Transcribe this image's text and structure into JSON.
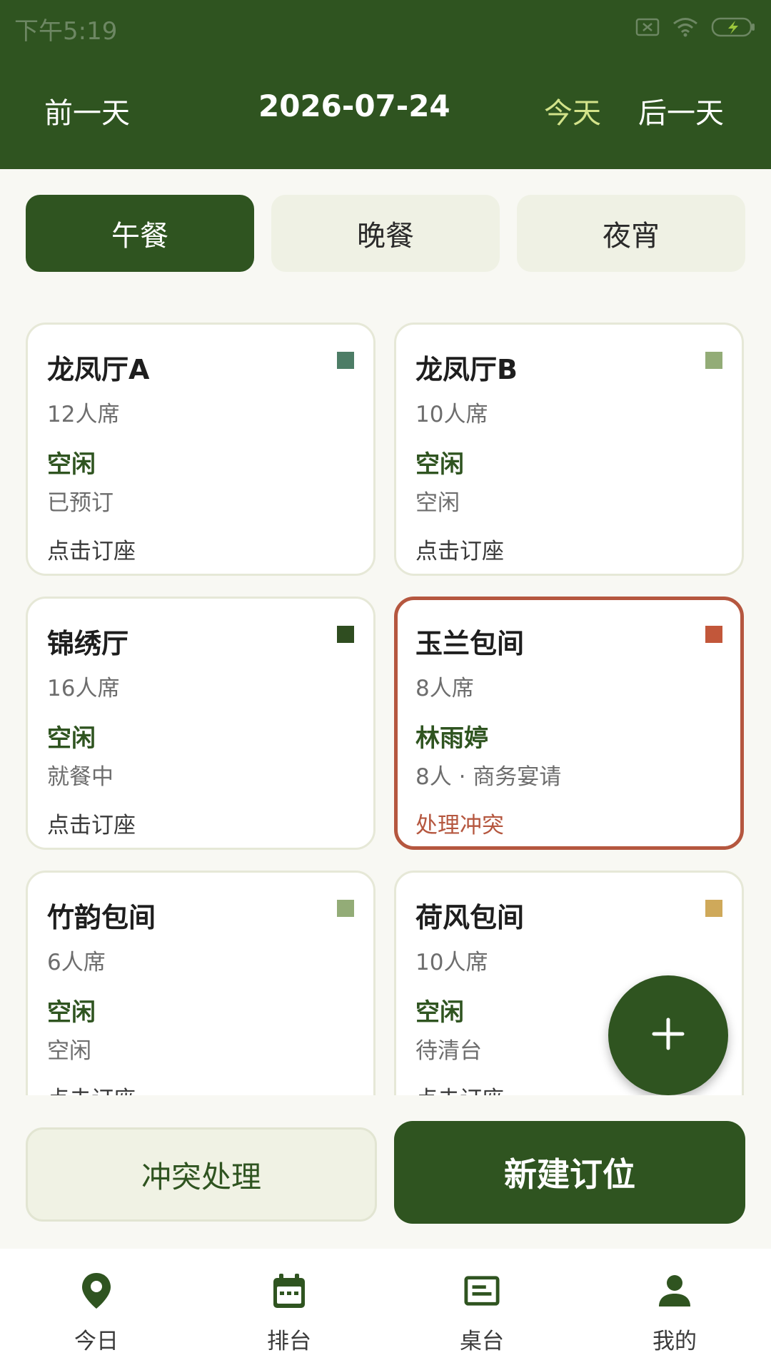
{
  "status_bar": {
    "time": "下午5:19"
  },
  "header": {
    "prev_label": "前一天",
    "date": "2026-07-24",
    "today_label": "今天",
    "next_label": "后一天"
  },
  "meal_tabs": [
    {
      "label": "午餐",
      "active": true
    },
    {
      "label": "晚餐",
      "active": false
    },
    {
      "label": "夜宵",
      "active": false
    }
  ],
  "rooms": [
    {
      "name": "龙凤厅A",
      "seats": "12人席",
      "status": "空闲",
      "detail": "已预订",
      "action": "点击订座",
      "color": "#4d7d66",
      "conflict": false
    },
    {
      "name": "龙凤厅B",
      "seats": "10人席",
      "status": "空闲",
      "detail": "空闲",
      "action": "点击订座",
      "color": "#93ac77",
      "conflict": false
    },
    {
      "name": "锦绣厅",
      "seats": "16人席",
      "status": "空闲",
      "detail": "就餐中",
      "action": "点击订座",
      "color": "#2f4d20",
      "conflict": false
    },
    {
      "name": "玉兰包间",
      "seats": "8人席",
      "status": "林雨婷",
      "detail": "8人 · 商务宴请",
      "action": "处理冲突",
      "color": "#c2573a",
      "conflict": true
    },
    {
      "name": "竹韵包间",
      "seats": "6人席",
      "status": "空闲",
      "detail": "空闲",
      "action": "点击订座",
      "color": "#93ac77",
      "conflict": false
    },
    {
      "name": "荷风包间",
      "seats": "10人席",
      "status": "空闲",
      "detail": "待清台",
      "action": "点击订座",
      "color": "#cfa95a",
      "conflict": false
    }
  ],
  "actions": {
    "conflict_label": "冲突处理",
    "new_label": "新建订位"
  },
  "bottom_nav": [
    {
      "label": "今日",
      "icon": "location-pin-icon"
    },
    {
      "label": "排台",
      "icon": "calendar-icon"
    },
    {
      "label": "桌台",
      "icon": "table-card-icon"
    },
    {
      "label": "我的",
      "icon": "person-icon"
    }
  ],
  "colors": {
    "primary": "#2f5420",
    "accent_today": "#d3e38a",
    "conflict": "#b5573f",
    "background": "#f8f8f3"
  }
}
